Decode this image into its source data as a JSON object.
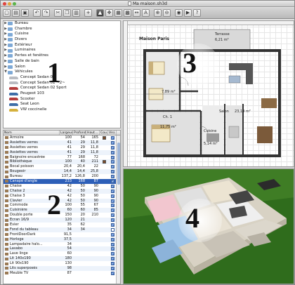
{
  "window": {
    "title": "Ma maison.sh3d"
  },
  "toolbar": {
    "buttons": [
      {
        "name": "new-button",
        "glyph": "▢"
      },
      {
        "name": "open-button",
        "glyph": "▤"
      },
      {
        "name": "save-button",
        "glyph": "▣"
      },
      {
        "name": "undo-button",
        "glyph": "↶"
      },
      {
        "name": "redo-button",
        "glyph": "↷"
      },
      {
        "name": "cut-button",
        "glyph": "✂"
      },
      {
        "name": "copy-button",
        "glyph": "❐"
      },
      {
        "name": "paste-button",
        "glyph": "▥"
      },
      {
        "name": "add-furniture-button",
        "glyph": "+"
      },
      {
        "name": "select-mode-button",
        "glyph": "▲",
        "active": true
      },
      {
        "name": "pan-mode-button",
        "glyph": "✥"
      },
      {
        "name": "create-walls-button",
        "glyph": "▦"
      },
      {
        "name": "create-rooms-button",
        "glyph": "▩"
      },
      {
        "name": "create-dimensions-button",
        "glyph": "↔"
      },
      {
        "name": "add-text-button",
        "glyph": "A"
      },
      {
        "name": "zoom-in-button",
        "glyph": "⊕"
      },
      {
        "name": "zoom-out-button",
        "glyph": "⊖"
      },
      {
        "name": "create-photo-button",
        "glyph": "◉"
      },
      {
        "name": "create-video-button",
        "glyph": "▶"
      },
      {
        "name": "help-button",
        "glyph": "?"
      }
    ]
  },
  "catalog": {
    "big_number": "1",
    "categories": [
      {
        "label": "Bureau",
        "expanded": false
      },
      {
        "label": "Chambre",
        "expanded": false
      },
      {
        "label": "Cuisine",
        "expanded": false
      },
      {
        "label": "Divers",
        "expanded": false
      },
      {
        "label": "Extérieur",
        "expanded": false
      },
      {
        "label": "Luminaires",
        "expanded": false
      },
      {
        "label": "Portes et fenêtres",
        "expanded": false
      },
      {
        "label": "Salle de bain",
        "expanded": false
      },
      {
        "label": "Salon",
        "expanded": false
      },
      {
        "label": "Véhicules",
        "expanded": true
      }
    ],
    "vehicles": [
      {
        "label": "Concept Sedan 01",
        "color": "silver"
      },
      {
        "label": "Concept Sedan 01 ~2~",
        "color": "silver"
      },
      {
        "label": "Concept Sedan 02 Sport",
        "color": "red"
      },
      {
        "label": "Peugeot 103",
        "color": "blue"
      },
      {
        "label": "Scooter",
        "color": "red"
      },
      {
        "label": "Seat Leon",
        "color": "blue"
      },
      {
        "label": "VW coccinelle",
        "color": "yellow"
      }
    ]
  },
  "furniture": {
    "big_number": "2",
    "columns": [
      "Nom",
      "Largeur",
      "Profond...",
      "Haut...",
      "Cou...",
      "Visi..."
    ],
    "rows": [
      {
        "name": "Armoire",
        "w": "100",
        "d": "54",
        "h": "165",
        "color": "#7a4b2a",
        "visible": true
      },
      {
        "name": "Assiettes verres",
        "w": "41",
        "d": "29",
        "h": "11,8",
        "color": "",
        "visible": true
      },
      {
        "name": "Assiettes verres",
        "w": "41",
        "d": "29",
        "h": "11,8",
        "color": "",
        "visible": true
      },
      {
        "name": "Assiettes verres",
        "w": "41",
        "d": "29",
        "h": "11,8",
        "color": "",
        "visible": true
      },
      {
        "name": "Baignoire encastrée",
        "w": "77",
        "d": "168",
        "h": "72",
        "color": "",
        "visible": true
      },
      {
        "name": "Bibliothèque",
        "w": "100",
        "d": "40",
        "h": "211",
        "color": "#7a4b2a",
        "visible": true
      },
      {
        "name": "Bocal poisson",
        "w": "20,4",
        "d": "20,4",
        "h": "22",
        "color": "",
        "visible": true
      },
      {
        "name": "Bougeoir",
        "w": "14,4",
        "d": "14,4",
        "h": "25,8",
        "color": "",
        "visible": true
      },
      {
        "name": "Bureau",
        "w": "137,2",
        "d": "126,8",
        "h": "200",
        "color": "",
        "visible": true
      },
      {
        "name": "Canapé d'angle",
        "w": "233",
        "d": "168",
        "h": "87",
        "color": "",
        "visible": true,
        "selected": true
      },
      {
        "name": "Chaise",
        "w": "42",
        "d": "50",
        "h": "90",
        "color": "",
        "visible": true
      },
      {
        "name": "Chaise 2",
        "w": "42",
        "d": "50",
        "h": "90",
        "color": "",
        "visible": true
      },
      {
        "name": "Chaise 3",
        "w": "42",
        "d": "50",
        "h": "90",
        "color": "",
        "visible": true
      },
      {
        "name": "Clavier",
        "w": "42",
        "d": "50",
        "h": "90",
        "color": "",
        "visible": true
      },
      {
        "name": "Commode",
        "w": "100",
        "d": "55",
        "h": "67",
        "color": "",
        "visible": true
      },
      {
        "name": "Cuisinière",
        "w": "60",
        "d": "60",
        "h": "85",
        "color": "",
        "visible": true
      },
      {
        "name": "Double porte",
        "w": "150",
        "d": "20",
        "h": "210",
        "color": "",
        "visible": true
      },
      {
        "name": "Ecran 16/9",
        "w": "120",
        "d": "21",
        "h": "",
        "color": "",
        "visible": true
      },
      {
        "name": "Evier",
        "w": "35",
        "d": "62",
        "h": "",
        "color": "",
        "visible": true
      },
      {
        "name": "Fond du tableau",
        "w": "34",
        "d": "34",
        "h": "",
        "color": "",
        "visible": false
      },
      {
        "name": "FrontDoorDark",
        "w": "91,5",
        "d": "",
        "h": "",
        "color": "",
        "visible": true
      },
      {
        "name": "Horloge",
        "w": "37,5",
        "d": "",
        "h": "",
        "color": "",
        "visible": true
      },
      {
        "name": "Lampadaire halo...",
        "w": "34",
        "d": "",
        "h": "",
        "color": "",
        "visible": true
      },
      {
        "name": "Lavabo",
        "w": "54",
        "d": "",
        "h": "",
        "color": "",
        "visible": true
      },
      {
        "name": "Lave linge",
        "w": "60",
        "d": "",
        "h": "",
        "color": "",
        "visible": true
      },
      {
        "name": "Lit 140x190",
        "w": "180",
        "d": "",
        "h": "",
        "color": "",
        "visible": true
      },
      {
        "name": "Lit 90x190",
        "w": "130",
        "d": "",
        "h": "",
        "color": "",
        "visible": true
      },
      {
        "name": "Lits superposés",
        "w": "98",
        "d": "",
        "h": "",
        "color": "",
        "visible": true
      },
      {
        "name": "Meuble TV",
        "w": "87",
        "d": "",
        "h": "",
        "color": "",
        "visible": true
      }
    ]
  },
  "plan": {
    "big_number": "3",
    "title": "Maison Paris",
    "labels": [
      {
        "key": "terrasse",
        "text": "Terrasse"
      },
      {
        "key": "terrasse_area",
        "text": "6,21 m²"
      },
      {
        "key": "living_area",
        "text": "7,89 m²"
      },
      {
        "key": "ch1",
        "text": "Ch. 1"
      },
      {
        "key": "ch1_area",
        "text": "11,75 m²"
      },
      {
        "key": "salon",
        "text": "Salon"
      },
      {
        "key": "salon_area",
        "text": "23,19 m²"
      },
      {
        "key": "cuisine",
        "text": "Cuisine"
      },
      {
        "key": "cuisine_area",
        "text": "5,14 m²"
      }
    ]
  },
  "view3d": {
    "big_number": "4"
  }
}
